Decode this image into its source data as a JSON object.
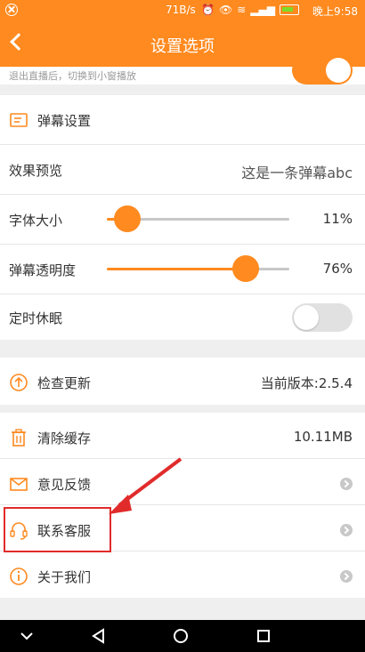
{
  "status_bar": {
    "speed": "71B/s",
    "time": "晚上9:58",
    "icons": [
      "alarm-icon",
      "eye-icon",
      "wifi-icon",
      "signal-icon",
      "battery-icon"
    ],
    "battery_color": "#7cdc2a"
  },
  "header": {
    "title": "设置选项",
    "background": "#ff8a1f"
  },
  "top_partial": {
    "text": "退出直播后，切换到小窗播放",
    "toggle_on": true
  },
  "danmaku": {
    "section_title": "弹幕设置",
    "preview_label": "效果预览",
    "preview_text": "这是一条弹幕abc",
    "font_size_label": "字体大小",
    "font_size_value": "11%",
    "font_size_fraction": 0.11,
    "opacity_label": "弹幕透明度",
    "opacity_value": "76%",
    "opacity_fraction": 0.76,
    "sleep_label": "定时休眠",
    "sleep_on": false
  },
  "update": {
    "label": "检查更新",
    "value": "当前版本:2.5.4"
  },
  "misc": {
    "clear_cache_label": "清除缓存",
    "clear_cache_value": "10.11MB",
    "feedback_label": "意见反馈",
    "contact_label": "联系客服",
    "about_label": "关于我们"
  },
  "nav": {
    "icons": [
      "nav-down-icon",
      "nav-back-icon",
      "nav-home-icon",
      "nav-recent-icon"
    ]
  },
  "accent_color": "#ff8a1f"
}
